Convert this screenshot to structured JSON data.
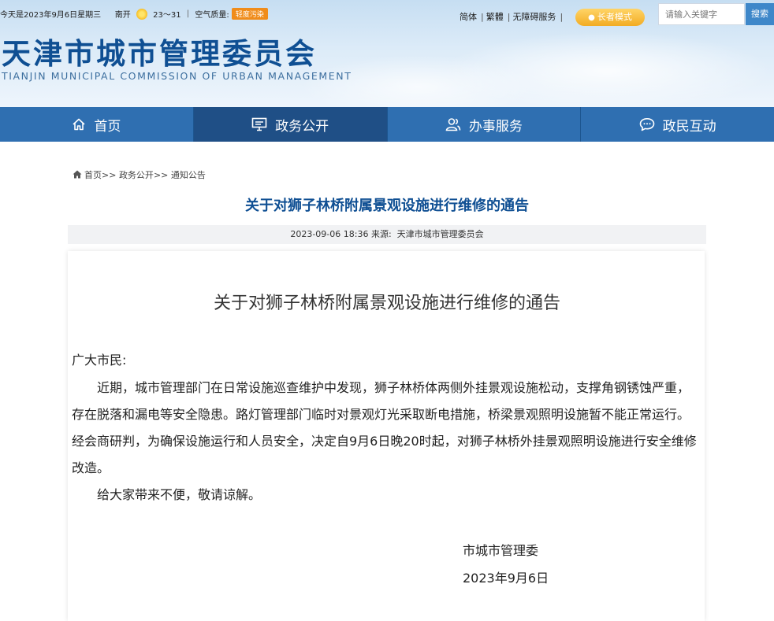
{
  "topbar": {
    "date": "今天是2023年9月6日星期三",
    "district": "南开",
    "temp": "23～31",
    "aq_label": "空气质量:",
    "aq_value": "轻度污染"
  },
  "tools": {
    "simplified": "简体",
    "traditional": "繁體",
    "accessibility": "无障碍服务",
    "elder_mode": "长者模式",
    "search_placeholder": "请输入关键字",
    "search_button": "搜索"
  },
  "logo": {
    "cn": "天津市城市管理委员会",
    "en": "TIANJIN MUNICIPAL COMMISSION OF URBAN MANAGEMENT"
  },
  "nav": {
    "home": "首页",
    "gov": "政务公开",
    "service": "办事服务",
    "interact": "政民互动"
  },
  "breadcrumb": {
    "home": "首页",
    "sep": ">>",
    "level1": "政务公开",
    "level2": "通知公告"
  },
  "article": {
    "title": "关于对狮子林桥附属景观设施进行维修的通告",
    "date": "2023-09-06 18:36",
    "source_label": "来源:",
    "source": "天津市城市管理委员会",
    "doc_title": "关于对狮子林桥附属景观设施进行维修的通告",
    "salutation": "广大市民:",
    "paragraph1": "近期，城市管理部门在日常设施巡查维护中发现，狮子林桥体两侧外挂景观设施松动，支撑角钢锈蚀严重，存在脱落和漏电等安全隐患。路灯管理部门临时对景观灯光采取断电措施，桥梁景观照明设施暂不能正常运行。经会商研判，为确保设施运行和人员安全，决定自9月6日晚20时起，对狮子林桥外挂景观照明设施进行安全维修改造。",
    "paragraph2": "给大家带来不便，敬请谅解。",
    "signer": "市城市管理委",
    "sign_date": "2023年9月6日"
  },
  "colors": {
    "nav_bg": "#2f6fb1",
    "nav_active": "#1f4f86",
    "title_blue": "#0f4f93",
    "elder_orange": "#f2ac23"
  }
}
